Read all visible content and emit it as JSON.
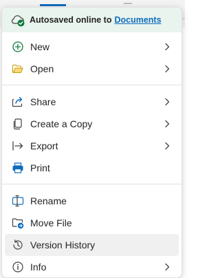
{
  "banner": {
    "text": "Autosaved online to",
    "link": "Documents",
    "icon": "cloud-check-icon"
  },
  "groups": [
    [
      {
        "name": "new",
        "label": "New",
        "icon": "add-circle-icon",
        "has_submenu": true
      },
      {
        "name": "open",
        "label": "Open",
        "icon": "folder-open-icon",
        "has_submenu": true
      }
    ],
    [
      {
        "name": "share",
        "label": "Share",
        "icon": "share-icon",
        "has_submenu": true
      },
      {
        "name": "create-copy",
        "label": "Create a Copy",
        "icon": "copy-icon",
        "has_submenu": true
      },
      {
        "name": "export",
        "label": "Export",
        "icon": "export-icon",
        "has_submenu": true
      },
      {
        "name": "print",
        "label": "Print",
        "icon": "printer-icon",
        "has_submenu": false
      }
    ],
    [
      {
        "name": "rename",
        "label": "Rename",
        "icon": "rename-icon",
        "has_submenu": false
      },
      {
        "name": "move-file",
        "label": "Move File",
        "icon": "folder-move-icon",
        "has_submenu": false
      },
      {
        "name": "version-history",
        "label": "Version History",
        "icon": "history-icon",
        "has_submenu": false,
        "highlighted": true
      },
      {
        "name": "info",
        "label": "Info",
        "icon": "info-icon",
        "has_submenu": true
      }
    ]
  ],
  "colors": {
    "banner_bg": "#e9f4ee",
    "success_green": "#0e7a3c",
    "accent_blue": "#0f6cbd",
    "hover_bg": "#f0f0f0"
  }
}
